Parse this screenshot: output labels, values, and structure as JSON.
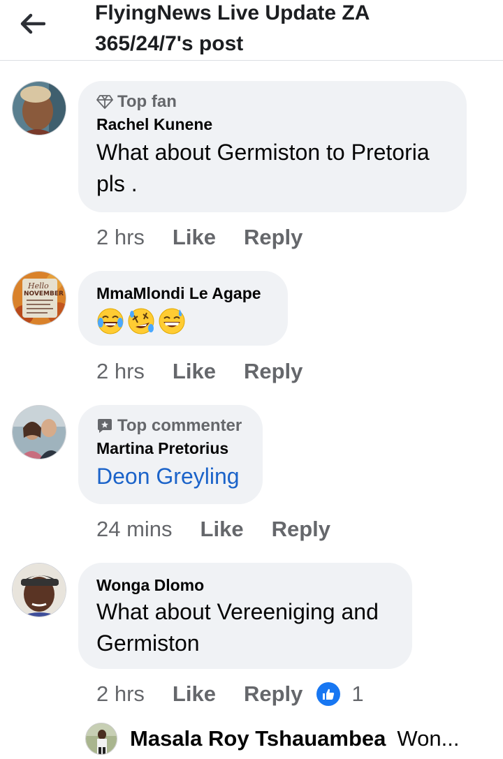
{
  "header": {
    "title_line1": "FlyingNews Live Update ZA",
    "title_line2": "365/24/7's post"
  },
  "comments": [
    {
      "badge": "Top fan",
      "badge_icon": "diamond-icon",
      "author": "Rachel Kunene",
      "text": "What about Germiston to Pretoria pls .",
      "time": "2 hrs",
      "like_label": "Like",
      "reply_label": "Reply"
    },
    {
      "author": "MmaMlondi Le Agape",
      "emojis": [
        "tears-of-joy-emoji",
        "rolling-laughing-emoji",
        "grinning-sweat-emoji"
      ],
      "avatar_text": {
        "line1": "Hello",
        "line2": "NOVEMBER"
      },
      "time": "2 hrs",
      "like_label": "Like",
      "reply_label": "Reply"
    },
    {
      "badge": "Top commenter",
      "badge_icon": "comment-star-icon",
      "author": "Martina Pretorius",
      "text": "Deon Greyling",
      "text_is_mention": true,
      "time": "24 mins",
      "like_label": "Like",
      "reply_label": "Reply"
    },
    {
      "author": "Wonga Dlomo",
      "text": "What about Vereeniging and Germiston",
      "time": "2 hrs",
      "like_label": "Like",
      "reply_label": "Reply",
      "reaction_icon": "like-reaction-icon",
      "reaction_count": "1"
    }
  ],
  "reply_preview": {
    "author": "Masala Roy Tshauambea",
    "snippet": "Won..."
  },
  "colors": {
    "bubble": "#f0f2f5",
    "secondary_text": "#65676b",
    "mention_link": "#1b63c9",
    "like_blue": "#1877f2"
  }
}
